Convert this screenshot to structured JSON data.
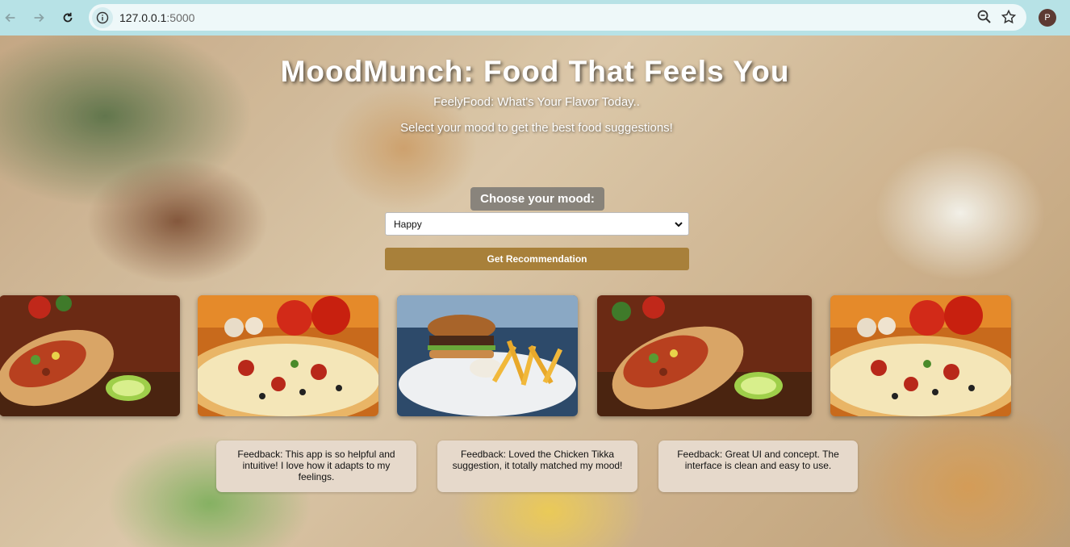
{
  "browser": {
    "url_host": "127.0.0.1",
    "url_port": ":5000",
    "profile_initial": "P"
  },
  "header": {
    "title": "MoodMunch: Food That Feels You",
    "subtitle": "FeelyFood: What's Your Flavor Today..",
    "instructions": "Select your mood to get the best food suggestions!"
  },
  "mood": {
    "label": "Choose your mood:",
    "selected": "Happy",
    "button_label": "Get Recommendation"
  },
  "food_cards": [
    {
      "icon": "wrap-image"
    },
    {
      "icon": "pizza-image"
    },
    {
      "icon": "burger-fries-image"
    },
    {
      "icon": "wrap-image"
    },
    {
      "icon": "pizza-image"
    }
  ],
  "feedback": [
    {
      "text": "Feedback: This app is so helpful and intuitive! I love how it adapts to my feelings."
    },
    {
      "text": "Feedback: Loved the Chicken Tikka suggestion, it totally matched my mood!"
    },
    {
      "text": "Feedback: Great UI and concept. The interface is clean and easy to use."
    }
  ],
  "colors": {
    "button": "#a8803a",
    "feedback_bg": "#e6d9cb",
    "chrome": "#b7e2e6"
  }
}
